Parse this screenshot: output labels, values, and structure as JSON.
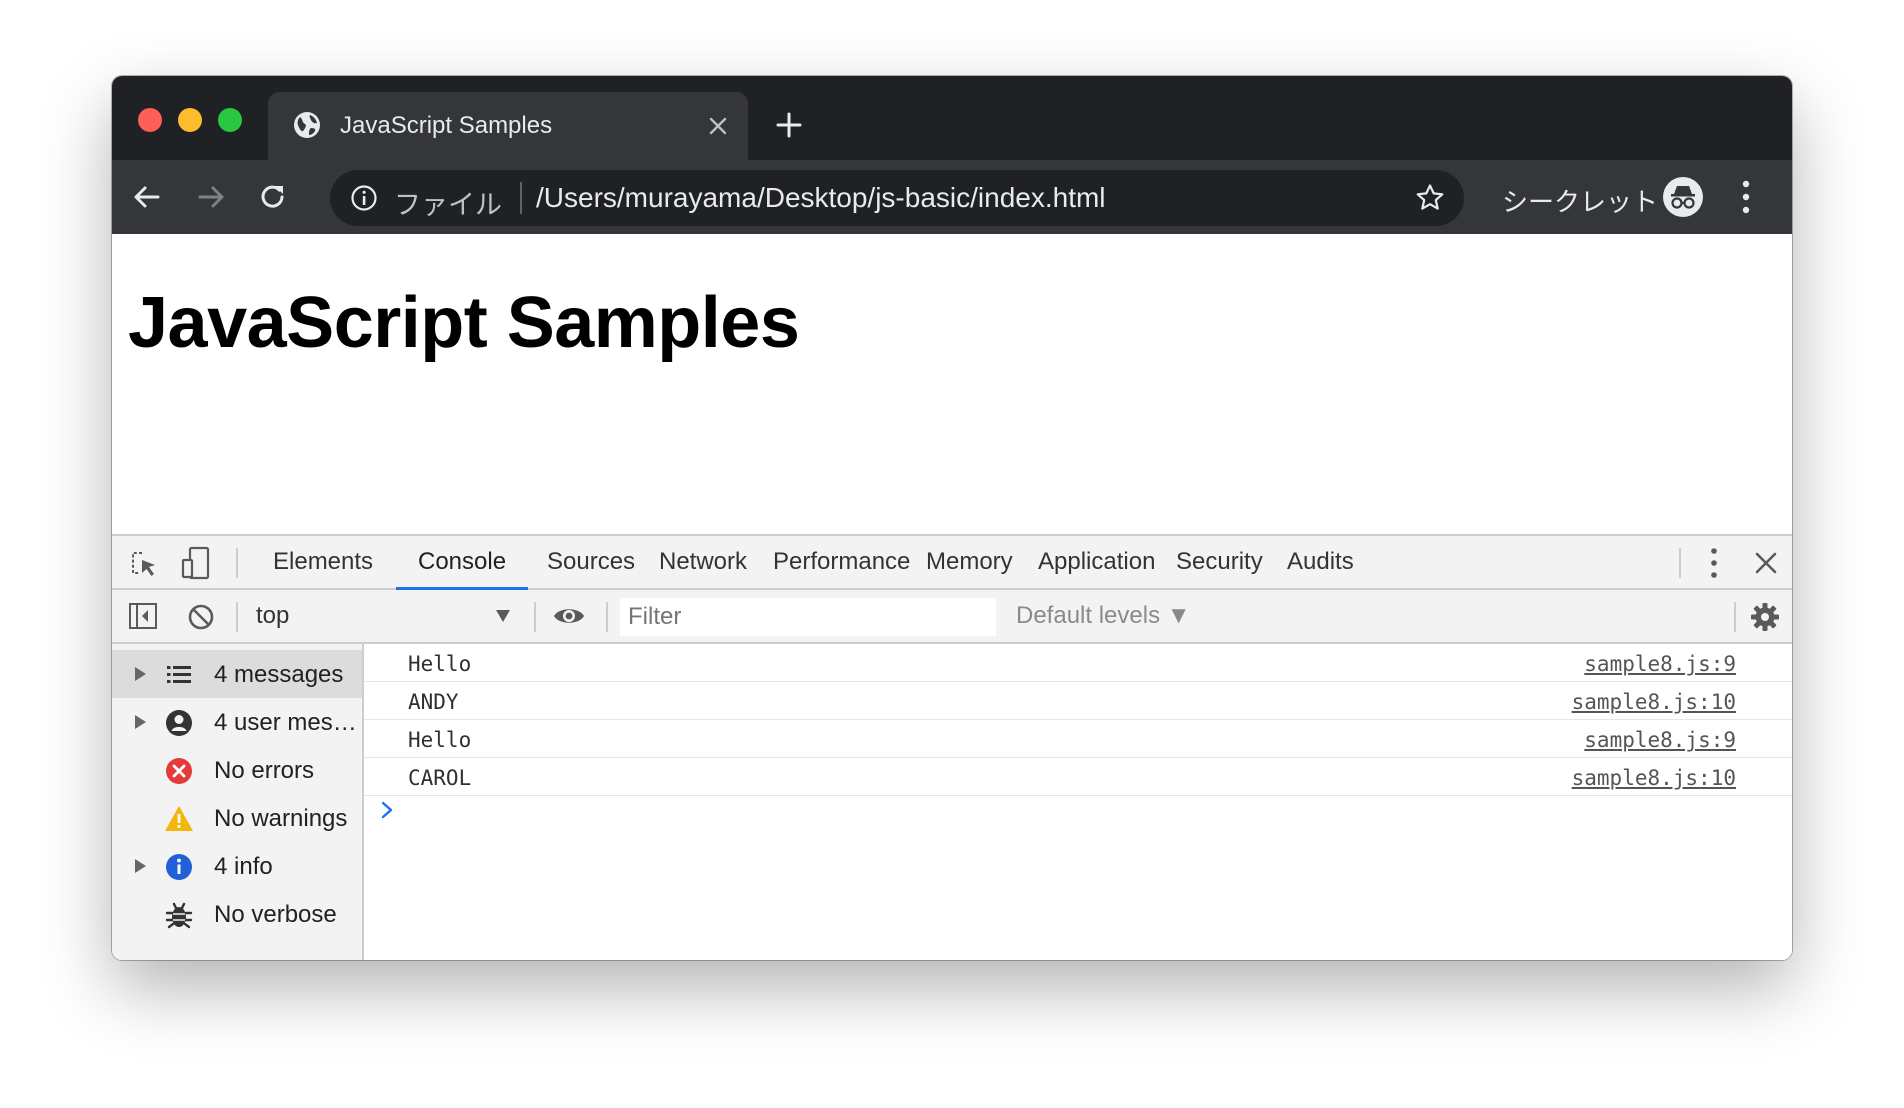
{
  "tab": {
    "title": "JavaScript Samples"
  },
  "omnibox": {
    "scheme_label": "ファイル",
    "url": "/Users/murayama/Desktop/js-basic/index.html"
  },
  "profile": {
    "label": "シークレット"
  },
  "page": {
    "heading": "JavaScript Samples"
  },
  "devtools": {
    "tabs": [
      {
        "label": "Elements"
      },
      {
        "label": "Console"
      },
      {
        "label": "Sources"
      },
      {
        "label": "Network"
      },
      {
        "label": "Performance"
      },
      {
        "label": "Memory"
      },
      {
        "label": "Application"
      },
      {
        "label": "Security"
      },
      {
        "label": "Audits"
      }
    ],
    "active_tab": "Console",
    "context": "top",
    "filter_placeholder": "Filter",
    "levels_label": "Default levels ▼",
    "sidebar": [
      {
        "label": "4 messages",
        "icon": "list-icon"
      },
      {
        "label": "4 user messages",
        "icon": "user-icon"
      },
      {
        "label": "No errors",
        "icon": "error-icon"
      },
      {
        "label": "No warnings",
        "icon": "warning-icon"
      },
      {
        "label": "4 info",
        "icon": "info-icon"
      },
      {
        "label": "No verbose",
        "icon": "bug-icon"
      }
    ],
    "logs": [
      {
        "message": "Hello",
        "source": "sample8.js:9"
      },
      {
        "message": "ANDY",
        "source": "sample8.js:10"
      },
      {
        "message": "Hello",
        "source": "sample8.js:9"
      },
      {
        "message": "CAROL",
        "source": "sample8.js:10"
      }
    ]
  },
  "colors": {
    "accent": "#1a73e8",
    "frame": "#202124",
    "toolbar": "#35363a"
  }
}
